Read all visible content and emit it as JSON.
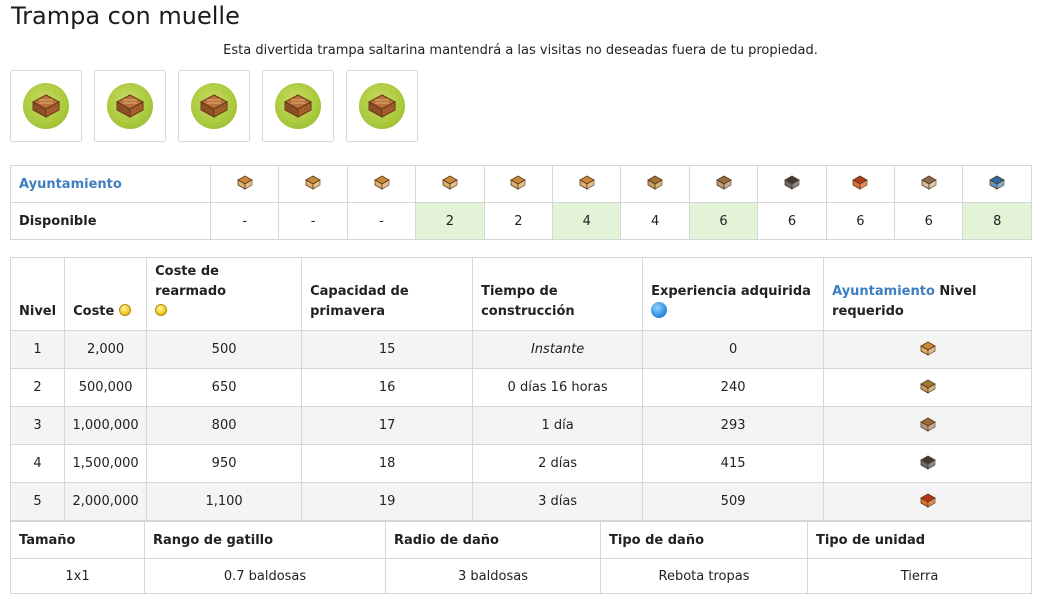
{
  "page": {
    "title": "Trampa con muelle",
    "intro": "Esta divertida trampa saltarina mantendrá a las visitas no deseadas fuera de tu propiedad."
  },
  "gallery": {
    "items": [
      {
        "icon": "spring-trap-icon"
      },
      {
        "icon": "spring-trap-icon"
      },
      {
        "icon": "spring-trap-icon"
      },
      {
        "icon": "spring-trap-icon"
      },
      {
        "icon": "spring-trap-icon"
      }
    ]
  },
  "town_hall_table": {
    "row1_label": "Ayuntamiento",
    "row2_label": "Disponible",
    "town_halls": [
      {
        "icon": "town-hall-1-icon",
        "roof": "#c8893a",
        "wall": "#e0b070"
      },
      {
        "icon": "town-hall-2-icon",
        "roof": "#c8893a",
        "wall": "#e0b070"
      },
      {
        "icon": "town-hall-3-icon",
        "roof": "#c8893a",
        "wall": "#e0b070"
      },
      {
        "icon": "town-hall-4-icon",
        "roof": "#c8893a",
        "wall": "#e0b070"
      },
      {
        "icon": "town-hall-5-icon",
        "roof": "#c8893a",
        "wall": "#e0b070"
      },
      {
        "icon": "town-hall-6-icon",
        "roof": "#c8893a",
        "wall": "#e0b070"
      },
      {
        "icon": "town-hall-7-icon",
        "roof": "#a0743a",
        "wall": "#c9a060"
      },
      {
        "icon": "town-hall-8-icon",
        "roof": "#9a6a40",
        "wall": "#b99a80"
      },
      {
        "icon": "town-hall-9-icon",
        "roof": "#3a3a40",
        "wall": "#666a70"
      },
      {
        "icon": "town-hall-10-icon",
        "roof": "#b03a1a",
        "wall": "#e07030"
      },
      {
        "icon": "town-hall-11-icon",
        "roof": "#8a6a50",
        "wall": "#d0c0a0"
      },
      {
        "icon": "town-hall-12-icon",
        "roof": "#2a6aa8",
        "wall": "#5a9ad0"
      }
    ],
    "available": [
      "-",
      "-",
      "-",
      "2",
      "2",
      "4",
      "4",
      "6",
      "6",
      "6",
      "6",
      "8"
    ],
    "highlight_color": "#e2f3d8",
    "highlighted": [
      false,
      false,
      false,
      true,
      false,
      true,
      false,
      true,
      false,
      false,
      false,
      true
    ]
  },
  "levels_table": {
    "headers": {
      "level": "Nivel",
      "cost": "Coste",
      "rearm_cost": "Coste de rearmado",
      "capacity": "Capacidad de primavera",
      "build_time": "Tiempo de construcción",
      "experience": "Experiencia adquirida",
      "th_link": "Ayuntamiento",
      "th_suffix": " Nivel requerido"
    },
    "rows": [
      {
        "level": "1",
        "cost": "2,000",
        "rearm": "500",
        "capacity": "15",
        "time": "Instante",
        "xp": "0",
        "th_icon": "town-hall-4-icon"
      },
      {
        "level": "2",
        "cost": "500,000",
        "rearm": "650",
        "capacity": "16",
        "time": "0 días 16 horas",
        "xp": "240",
        "th_icon": "town-hall-7-icon"
      },
      {
        "level": "3",
        "cost": "1,000,000",
        "rearm": "800",
        "capacity": "17",
        "time": "1 día",
        "xp": "293",
        "th_icon": "town-hall-8-icon"
      },
      {
        "level": "4",
        "cost": "1,500,000",
        "rearm": "950",
        "capacity": "18",
        "time": "2 días",
        "xp": "415",
        "th_icon": "town-hall-9-icon"
      },
      {
        "level": "5",
        "cost": "2,000,000",
        "rearm": "1,100",
        "capacity": "19",
        "time": "3 días",
        "xp": "509",
        "th_icon": "town-hall-10-icon"
      }
    ]
  },
  "stats_table": {
    "headers": [
      "Tamaño",
      "Rango de gatillo",
      "Radio de daño",
      "Tipo de daño",
      "Tipo de unidad"
    ],
    "values": [
      "1x1",
      "0.7 baldosas",
      "3 baldosas",
      "Rebota tropas",
      "Tierra"
    ]
  },
  "colors": {
    "link": "#3f7fc0",
    "grass": "#a9c93d",
    "border": "#d6d6d6"
  }
}
